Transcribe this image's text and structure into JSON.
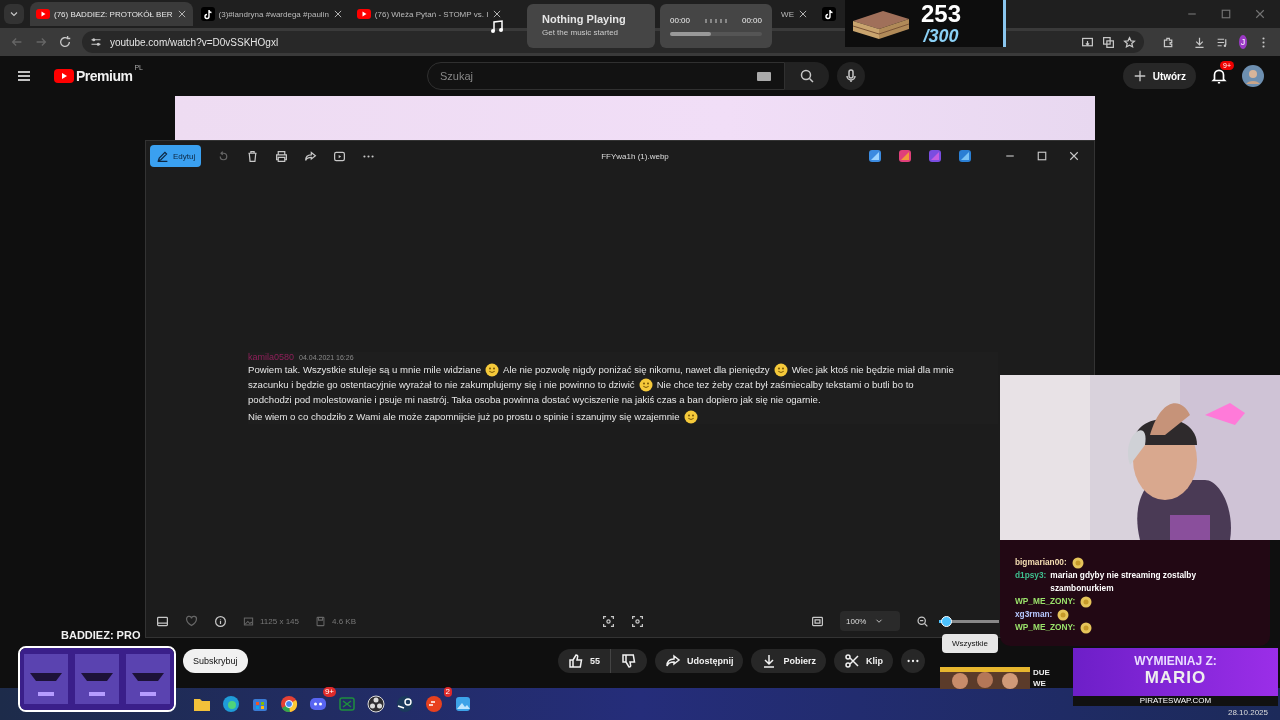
{
  "browser": {
    "tabs": [
      {
        "label": "(76) BADDIEZ: PROTOKÓŁ BER",
        "kind": "youtube",
        "selected": true
      },
      {
        "label": "(3)#landryna #wardega #paulin",
        "kind": "tiktok",
        "selected": false
      },
      {
        "label": "(76) Wieża Pytań - STOMP vs. I",
        "kind": "youtube",
        "selected": false
      },
      {
        "label": "WE",
        "kind": "plain",
        "selected": false
      },
      {
        "kind": "tiktok",
        "selected": false
      }
    ],
    "url": "youtube.com/watch?v=D0vSSKHOgxl",
    "profile_initial": "J"
  },
  "youtube": {
    "logo": "Premium",
    "region": "PL",
    "search": {
      "placeholder": "Szukaj"
    },
    "create": "Utwórz",
    "notifications": "9+",
    "video_title": "BADDIEZ: PRO",
    "subscribe": "Subskrybuj",
    "likes": "55",
    "actions": [
      {
        "kind": "share",
        "label": "Udostępnij"
      },
      {
        "kind": "download",
        "label": "Pobierz"
      },
      {
        "kind": "clip",
        "label": "Klip"
      }
    ],
    "filter_tooltip": "Wszystkie",
    "recommended": {
      "title": "DUE",
      "subtitle": "WE"
    }
  },
  "viewer": {
    "edit": "Edytuj",
    "file_name": "FFYwa1h (1).webp",
    "message": {
      "user": "kamila0580",
      "time": "04.04.2021 16:26",
      "lines": [
        [
          {
            "kind": "text",
            "text": "Powiem tak. Wszystkie stuleje są u mnie mile widziane"
          },
          {
            "kind": "emoji"
          },
          {
            "kind": "text",
            "text": "Ale nie pozwolę nigdy poniżać się nikomu, nawet dla pieniędzy"
          },
          {
            "kind": "emoji"
          },
          {
            "kind": "text",
            "text": "Wiec jak ktoś nie będzie miał dla mnie"
          }
        ],
        [
          {
            "kind": "text",
            "text": "szacunku i będzie go ostentacyjnie wyrażał to nie zakumplujemy się i nie powinno to dziwić"
          },
          {
            "kind": "emoji"
          },
          {
            "kind": "text",
            "text": "Nie chce tez żeby czat był zaśmiecalby tekstami o butli bo to"
          }
        ],
        [
          {
            "kind": "text",
            "text": "podchodzi pod molestowanie i psuje mi nastrój. Taka osoba powinna dostać wyciszenie na jakiś czas a ban dopiero jak się nie ogarnie."
          }
        ],
        [
          {
            "kind": "text",
            "text": "Nie wiem o co chodziło z Wami ale może zapomnijcie już po prostu o spinie i szanujmy się wzajemnie"
          },
          {
            "kind": "emoji"
          }
        ]
      ]
    },
    "dimensions": "1125 x 145",
    "size": "4.6 KB",
    "zoom": "100%",
    "zoom_slider": {
      "level": 0.12
    }
  },
  "music_widget": {
    "title": "Nothing Playing",
    "subtitle": "Get the music started",
    "elapsed": "00:00",
    "total": "00:00",
    "progress": {
      "level": 0.45
    }
  },
  "counter": {
    "value": "253",
    "goal": "/300"
  },
  "chat": [
    {
      "user": "bigmarian00:",
      "color": "#f5deb3",
      "emote": true
    },
    {
      "user": "d1psy3:",
      "color": "#3fbf8f",
      "text": "marian gdyby nie streaming zostalby szambonurkiem",
      "emote": false
    },
    {
      "user": "WP_ME_ZONY:",
      "color": "#9be36b",
      "emote": true
    },
    {
      "user": "xg3rman:",
      "color": "#b7c8ff",
      "emote": true
    },
    {
      "user": "WP_ME_ZONY:",
      "color": "#9be36b",
      "emote": true
    }
  ],
  "ad": {
    "line1": "WYMIENIAJ Z:",
    "line2": "MARIO",
    "site": "PIRATESWAP.COM"
  },
  "taskbar": {
    "apps": [
      {
        "kind": "folder"
      },
      {
        "kind": "edge"
      },
      {
        "kind": "store"
      },
      {
        "kind": "chrome"
      },
      {
        "kind": "discord",
        "badge": "9+"
      },
      {
        "kind": "xbox"
      },
      {
        "kind": "obs"
      },
      {
        "kind": "steam"
      },
      {
        "kind": "ea",
        "badge": "2"
      },
      {
        "kind": "photos"
      }
    ],
    "date": "28.10.2025"
  }
}
